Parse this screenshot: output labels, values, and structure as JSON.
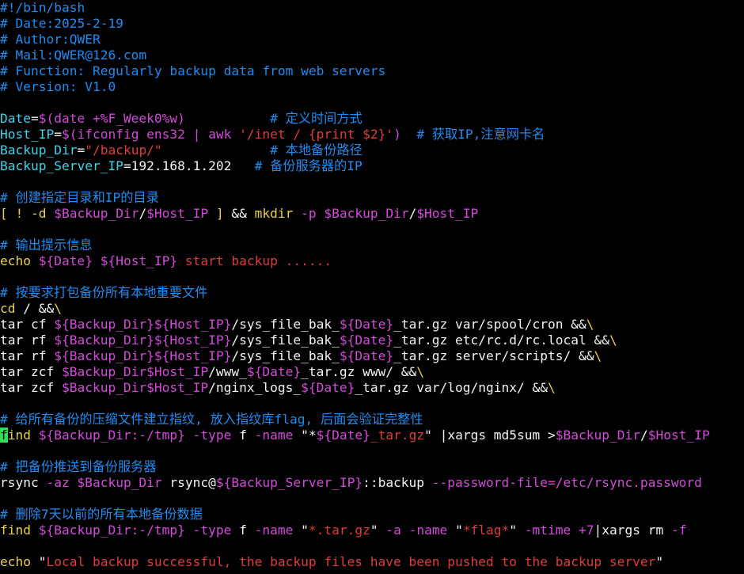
{
  "colors": {
    "background": "#000000",
    "comment": "#1f8cf2",
    "plain": "#f2f2f2",
    "variable_assign": "#3fd3e6",
    "variable_ref": "#d24bd8",
    "string": "#e03b3b",
    "operator": "#e8d146",
    "cursor": "#2fe05a"
  },
  "lines": [
    [
      {
        "t": "#!/bin/bash",
        "c": "comment"
      }
    ],
    [
      {
        "t": "# Date:2025-2-19",
        "c": "comment"
      }
    ],
    [
      {
        "t": "# Author:QWER",
        "c": "comment"
      }
    ],
    [
      {
        "t": "# Mail:QWER@126.com",
        "c": "comment"
      }
    ],
    [
      {
        "t": "# Function: Regularly backup data from web servers",
        "c": "comment"
      }
    ],
    [
      {
        "t": "# Version: V1.0",
        "c": "comment"
      }
    ],
    [],
    [
      {
        "t": "Date",
        "c": "cyan"
      },
      {
        "t": "=",
        "c": "white"
      },
      {
        "t": "$(date +%F_Week0%w)",
        "c": "magenta"
      },
      {
        "t": "           ",
        "c": "white"
      },
      {
        "t": "# 定义时间方式",
        "c": "comment"
      }
    ],
    [
      {
        "t": "Host_IP",
        "c": "cyan"
      },
      {
        "t": "=",
        "c": "white"
      },
      {
        "t": "$(ifconfig ens32 | awk ",
        "c": "magenta"
      },
      {
        "t": "'/inet / {print $2}'",
        "c": "red"
      },
      {
        "t": ")",
        "c": "magenta"
      },
      {
        "t": "  ",
        "c": "white"
      },
      {
        "t": "# 获取IP,注意网卡名",
        "c": "comment"
      }
    ],
    [
      {
        "t": "Backup_Dir",
        "c": "cyan"
      },
      {
        "t": "=",
        "c": "white"
      },
      {
        "t": "\"/backup/\"",
        "c": "red"
      },
      {
        "t": "              ",
        "c": "white"
      },
      {
        "t": "# 本地备份路径",
        "c": "comment"
      }
    ],
    [
      {
        "t": "Backup_Server_IP",
        "c": "cyan"
      },
      {
        "t": "=192.168.1.202   ",
        "c": "white"
      },
      {
        "t": "# 备份服务器的IP",
        "c": "comment"
      }
    ],
    [],
    [
      {
        "t": "# 创建指定目录和IP的目录",
        "c": "comment"
      }
    ],
    [
      {
        "t": "[ ! -d ",
        "c": "yellow"
      },
      {
        "t": "$Backup_Dir",
        "c": "magenta"
      },
      {
        "t": "/",
        "c": "white"
      },
      {
        "t": "$Host_IP",
        "c": "magenta"
      },
      {
        "t": " ]",
        "c": "yellow"
      },
      {
        "t": " && ",
        "c": "white"
      },
      {
        "t": "mkdir",
        "c": "yellow"
      },
      {
        "t": " -p ",
        "c": "magenta"
      },
      {
        "t": "$Backup_Dir",
        "c": "magenta"
      },
      {
        "t": "/",
        "c": "white"
      },
      {
        "t": "$Host_IP",
        "c": "magenta"
      }
    ],
    [],
    [
      {
        "t": "# 输出提示信息",
        "c": "comment"
      }
    ],
    [
      {
        "t": "echo",
        "c": "yellow"
      },
      {
        "t": " ",
        "c": "white"
      },
      {
        "t": "${Date}",
        "c": "magenta"
      },
      {
        "t": " ",
        "c": "white"
      },
      {
        "t": "${Host_IP}",
        "c": "magenta"
      },
      {
        "t": " start backup ......",
        "c": "red"
      }
    ],
    [],
    [
      {
        "t": "# 按要求打包备份所有本地重要文件",
        "c": "comment"
      }
    ],
    [
      {
        "t": "cd",
        "c": "yellow"
      },
      {
        "t": " / &&",
        "c": "white"
      },
      {
        "t": "\\",
        "c": "yellow"
      }
    ],
    [
      {
        "t": "tar cf ",
        "c": "white"
      },
      {
        "t": "${Backup_Dir}${Host_IP}",
        "c": "magenta"
      },
      {
        "t": "/sys_file_bak_",
        "c": "white"
      },
      {
        "t": "${Date}",
        "c": "magenta"
      },
      {
        "t": "_tar.gz var/spool/cron &&",
        "c": "white"
      },
      {
        "t": "\\",
        "c": "yellow"
      }
    ],
    [
      {
        "t": "tar rf ",
        "c": "white"
      },
      {
        "t": "${Backup_Dir}${Host_IP}",
        "c": "magenta"
      },
      {
        "t": "/sys_file_bak_",
        "c": "white"
      },
      {
        "t": "${Date}",
        "c": "magenta"
      },
      {
        "t": "_tar.gz etc/rc.d/rc.local &&",
        "c": "white"
      },
      {
        "t": "\\",
        "c": "yellow"
      }
    ],
    [
      {
        "t": "tar rf ",
        "c": "white"
      },
      {
        "t": "${Backup_Dir}${Host_IP}",
        "c": "magenta"
      },
      {
        "t": "/sys_file_bak_",
        "c": "white"
      },
      {
        "t": "${Date}",
        "c": "magenta"
      },
      {
        "t": "_tar.gz server/scripts/ &&",
        "c": "white"
      },
      {
        "t": "\\",
        "c": "yellow"
      }
    ],
    [
      {
        "t": "tar zcf ",
        "c": "white"
      },
      {
        "t": "$Backup_Dir$Host_IP",
        "c": "magenta"
      },
      {
        "t": "/www_",
        "c": "white"
      },
      {
        "t": "${Date}",
        "c": "magenta"
      },
      {
        "t": "_tar.gz www/ &&",
        "c": "white"
      },
      {
        "t": "\\",
        "c": "yellow"
      }
    ],
    [
      {
        "t": "tar zcf ",
        "c": "white"
      },
      {
        "t": "$Backup_Dir$Host_IP",
        "c": "magenta"
      },
      {
        "t": "/nginx_logs_",
        "c": "white"
      },
      {
        "t": "${Date}",
        "c": "magenta"
      },
      {
        "t": "_tar.gz var/log/nginx/ &&",
        "c": "white"
      },
      {
        "t": "\\",
        "c": "yellow"
      }
    ],
    [],
    [
      {
        "t": "# 给所有备份的压缩文件建立指纹, 放入指纹库flag, 后面会验证完整性",
        "c": "comment"
      }
    ],
    [
      {
        "t": "f",
        "c": "cursor"
      },
      {
        "t": "ind ",
        "c": "yellow"
      },
      {
        "t": "${Backup_Dir:-/tmp}",
        "c": "magenta"
      },
      {
        "t": " -type ",
        "c": "magenta"
      },
      {
        "t": "f",
        "c": "white"
      },
      {
        "t": " -name ",
        "c": "magenta"
      },
      {
        "t": "\"*",
        "c": "white"
      },
      {
        "t": "${Date}",
        "c": "magenta"
      },
      {
        "t": "_tar.gz",
        "c": "red"
      },
      {
        "t": "\"",
        "c": "white"
      },
      {
        "t": " |xargs md5sum >",
        "c": "white"
      },
      {
        "t": "$Backup_Dir",
        "c": "magenta"
      },
      {
        "t": "/",
        "c": "white"
      },
      {
        "t": "$Host_IP",
        "c": "magenta"
      }
    ],
    [],
    [
      {
        "t": "# 把备份推送到备份服务器",
        "c": "comment"
      }
    ],
    [
      {
        "t": "rsync",
        "c": "white"
      },
      {
        "t": " -az ",
        "c": "magenta"
      },
      {
        "t": "$Backup_Dir",
        "c": "magenta"
      },
      {
        "t": " rsync@",
        "c": "white"
      },
      {
        "t": "${Backup_Server_IP}",
        "c": "magenta"
      },
      {
        "t": "::backup ",
        "c": "white"
      },
      {
        "t": "--password-file=/etc/rsync.password",
        "c": "magenta"
      }
    ],
    [],
    [
      {
        "t": "# 删除7天以前的所有本地备份数据",
        "c": "comment"
      }
    ],
    [
      {
        "t": "find ",
        "c": "yellow"
      },
      {
        "t": "${Backup_Dir:-/tmp}",
        "c": "magenta"
      },
      {
        "t": " -type ",
        "c": "magenta"
      },
      {
        "t": "f",
        "c": "white"
      },
      {
        "t": " -name ",
        "c": "magenta"
      },
      {
        "t": "\"",
        "c": "white"
      },
      {
        "t": "*.tar.gz",
        "c": "red"
      },
      {
        "t": "\"",
        "c": "white"
      },
      {
        "t": " -a -name ",
        "c": "magenta"
      },
      {
        "t": "\"",
        "c": "white"
      },
      {
        "t": "*flag*",
        "c": "red"
      },
      {
        "t": "\"",
        "c": "white"
      },
      {
        "t": " -mtime +7",
        "c": "magenta"
      },
      {
        "t": "|xargs rm ",
        "c": "white"
      },
      {
        "t": "-f",
        "c": "magenta"
      }
    ],
    [],
    [
      {
        "t": "echo",
        "c": "yellow"
      },
      {
        "t": " \"",
        "c": "white"
      },
      {
        "t": "Local backup successful, the backup files have been pushed to the backup server",
        "c": "red"
      },
      {
        "t": "\"",
        "c": "white"
      }
    ]
  ]
}
